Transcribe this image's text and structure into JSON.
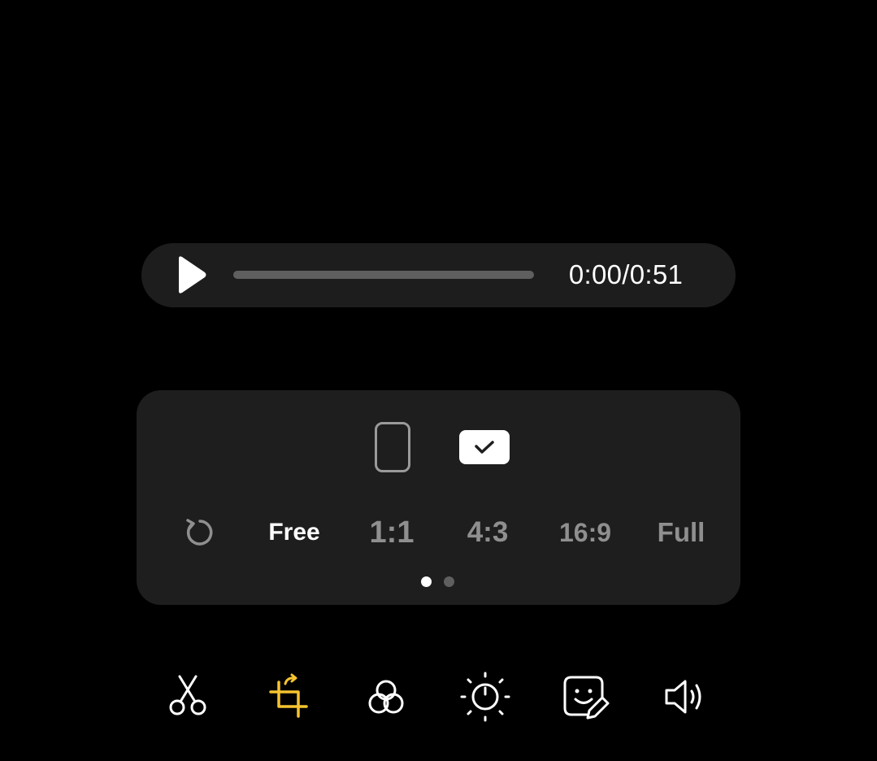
{
  "player": {
    "time": "0:00/0:51",
    "progress": 0.0,
    "play_icon": "play-icon"
  },
  "crop": {
    "orientations": [
      {
        "name": "portrait",
        "icon": "portrait-frame-icon",
        "selected": false
      },
      {
        "name": "landscape",
        "icon": "check-icon",
        "selected": true
      }
    ],
    "reset_icon": "rotate-reset-icon",
    "ratios": [
      {
        "label": "Free",
        "selected": true
      },
      {
        "label": "1:1",
        "selected": false
      },
      {
        "label": "4:3",
        "selected": false
      },
      {
        "label": "16:9",
        "selected": false
      },
      {
        "label": "Full",
        "selected": false
      }
    ],
    "page_indicator": {
      "count": 2,
      "current": 1
    }
  },
  "toolbar": {
    "tools": [
      {
        "name": "trim",
        "icon": "scissors-icon",
        "active": false
      },
      {
        "name": "crop-rotate",
        "icon": "crop-rotate-icon",
        "active": true
      },
      {
        "name": "filters",
        "icon": "filter-circles-icon",
        "active": false
      },
      {
        "name": "adjust",
        "icon": "brightness-icon",
        "active": false
      },
      {
        "name": "decorate",
        "icon": "sticker-edit-icon",
        "active": false
      },
      {
        "name": "audio",
        "icon": "speaker-icon",
        "active": false
      }
    ]
  },
  "colors": {
    "background": "#000000",
    "panel": "#1e1e1e",
    "accent": "#f6c430",
    "text_primary": "#ffffff",
    "text_muted": "#8f8f8f"
  }
}
